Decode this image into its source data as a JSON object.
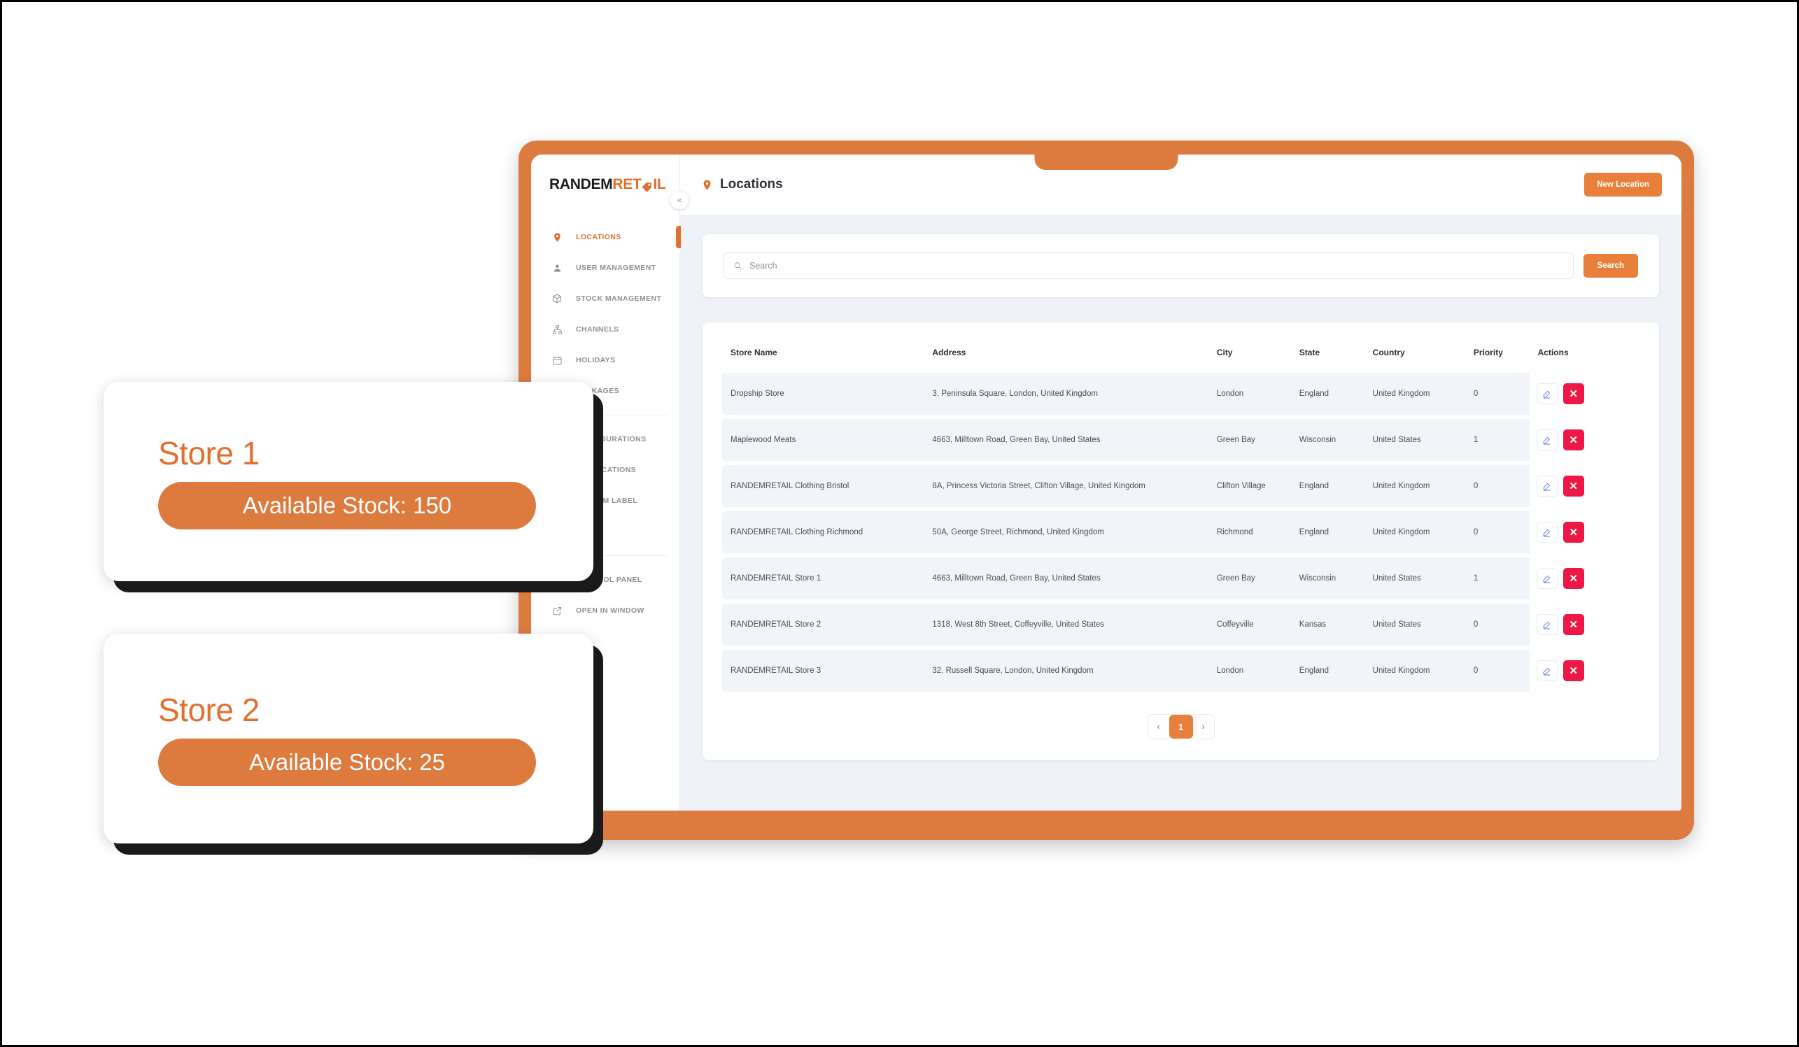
{
  "brand": {
    "logo_dark": "RANDEM",
    "logo_orange_1": "RET",
    "logo_orange_2": "IL",
    "tag_icon": "price-tag-icon"
  },
  "sidebar": {
    "collapse_glyph": "«",
    "items": [
      {
        "label": "LOCATIONS",
        "icon": "map-pin-icon",
        "active": true
      },
      {
        "label": "USER MANAGEMENT",
        "icon": "user-icon",
        "active": false
      },
      {
        "label": "STOCK MANAGEMENT",
        "icon": "box-icon",
        "active": false
      },
      {
        "label": "CHANNELS",
        "icon": "sitemap-icon",
        "active": false
      },
      {
        "label": "HOLIDAYS",
        "icon": "calendar-icon",
        "active": false
      },
      {
        "label": "PACKAGES",
        "icon": "package-icon",
        "active": false
      }
    ],
    "items_lower": [
      {
        "label": "CONFIGURATIONS",
        "icon": "sliders-icon",
        "active": false
      },
      {
        "label": "NOTIFICATIONS",
        "icon": "bell-icon",
        "active": false
      },
      {
        "label": "CUSTOM LABEL",
        "icon": "label-icon",
        "active": false
      },
      {
        "label": "",
        "icon": "tv-icon",
        "active": false
      }
    ],
    "items_footer": [
      {
        "label": "CONTROL PANEL",
        "icon": "panel-icon",
        "active": false
      },
      {
        "label": "OPEN IN WINDOW",
        "icon": "external-link-icon",
        "active": false
      }
    ]
  },
  "topbar": {
    "title": "Locations",
    "title_icon": "map-pin-icon",
    "new_location_label": "New Location"
  },
  "search": {
    "placeholder": "Search",
    "value": "",
    "icon": "search-icon",
    "button_label": "Search"
  },
  "table": {
    "columns": [
      "Store Name",
      "Address",
      "City",
      "State",
      "Country",
      "Priority",
      "Actions"
    ],
    "rows": [
      {
        "store_name": "Dropship Store",
        "address": "3, Peninsula Square, London, United Kingdom",
        "city": "London",
        "state": "England",
        "country": "United Kingdom",
        "priority": "0"
      },
      {
        "store_name": "Maplewood Meats",
        "address": "4663, Milltown Road, Green Bay, United States",
        "city": "Green Bay",
        "state": "Wisconsin",
        "country": "United States",
        "priority": "1"
      },
      {
        "store_name": "RANDEMRETAIL Clothing Bristol",
        "address": "8A, Princess Victoria Street, Clifton Village, United Kingdom",
        "city": "Clifton Village",
        "state": "England",
        "country": "United Kingdom",
        "priority": "0"
      },
      {
        "store_name": "RANDEMRETAIL Clothing Richmond",
        "address": "50A, George Street, Richmond, United Kingdom",
        "city": "Richmond",
        "state": "England",
        "country": "United Kingdom",
        "priority": "0"
      },
      {
        "store_name": "RANDEMRETAIL Store 1",
        "address": "4663, Milltown Road, Green Bay, United States",
        "city": "Green Bay",
        "state": "Wisconsin",
        "country": "United States",
        "priority": "1"
      },
      {
        "store_name": "RANDEMRETAIL Store 2",
        "address": "1318, West 8th Street, Coffeyville, United States",
        "city": "Coffeyville",
        "state": "Kansas",
        "country": "United States",
        "priority": "0"
      },
      {
        "store_name": "RANDEMRETAIL Store 3",
        "address": "32, Russell Square, London, United Kingdom",
        "city": "London",
        "state": "England",
        "country": "United Kingdom",
        "priority": "0"
      }
    ],
    "row_actions": {
      "edit_icon": "pencil-edit-icon",
      "delete_icon": "close-x-icon"
    }
  },
  "pagination": {
    "prev_glyph": "‹",
    "next_glyph": "›",
    "current_page": "1"
  },
  "stock_cards": [
    {
      "title": "Store 1",
      "pill": "Available Stock: 150"
    },
    {
      "title": "Store 2",
      "pill": "Available Stock: 25"
    }
  ],
  "colors": {
    "brand_orange": "#E0702F",
    "button_orange": "#E8803C",
    "frame_orange": "#DD7B3F",
    "delete_red": "#ED1846",
    "edit_blue": "#5B7CE0",
    "page_bg": "#EEF1F6",
    "row_bg": "#F1F4F8"
  }
}
